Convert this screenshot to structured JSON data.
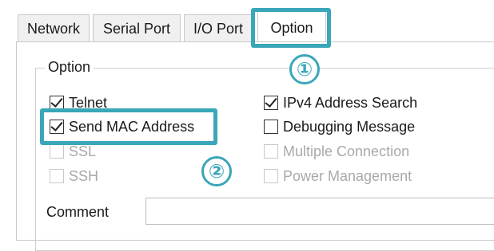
{
  "tabs": [
    {
      "label": "Network"
    },
    {
      "label": "Serial Port"
    },
    {
      "label": "I/O Port"
    },
    {
      "label": "Option"
    }
  ],
  "group": {
    "title": "Option"
  },
  "options_left": [
    {
      "label": "Telnet",
      "checked": true,
      "enabled": true
    },
    {
      "label": "Send MAC Address",
      "checked": true,
      "enabled": true
    },
    {
      "label": "SSL",
      "checked": false,
      "enabled": false
    },
    {
      "label": "SSH",
      "checked": false,
      "enabled": false
    }
  ],
  "options_right": [
    {
      "label": "IPv4 Address Search",
      "checked": true,
      "enabled": true
    },
    {
      "label": "Debugging Message",
      "checked": false,
      "enabled": true
    },
    {
      "label": "Multiple Connection",
      "checked": false,
      "enabled": false
    },
    {
      "label": "Power Management",
      "checked": false,
      "enabled": false
    }
  ],
  "comment": {
    "label": "Comment",
    "value": ""
  },
  "annotations": {
    "step1": "①",
    "step2": "②",
    "highlight_color": "#3aa6b9"
  }
}
